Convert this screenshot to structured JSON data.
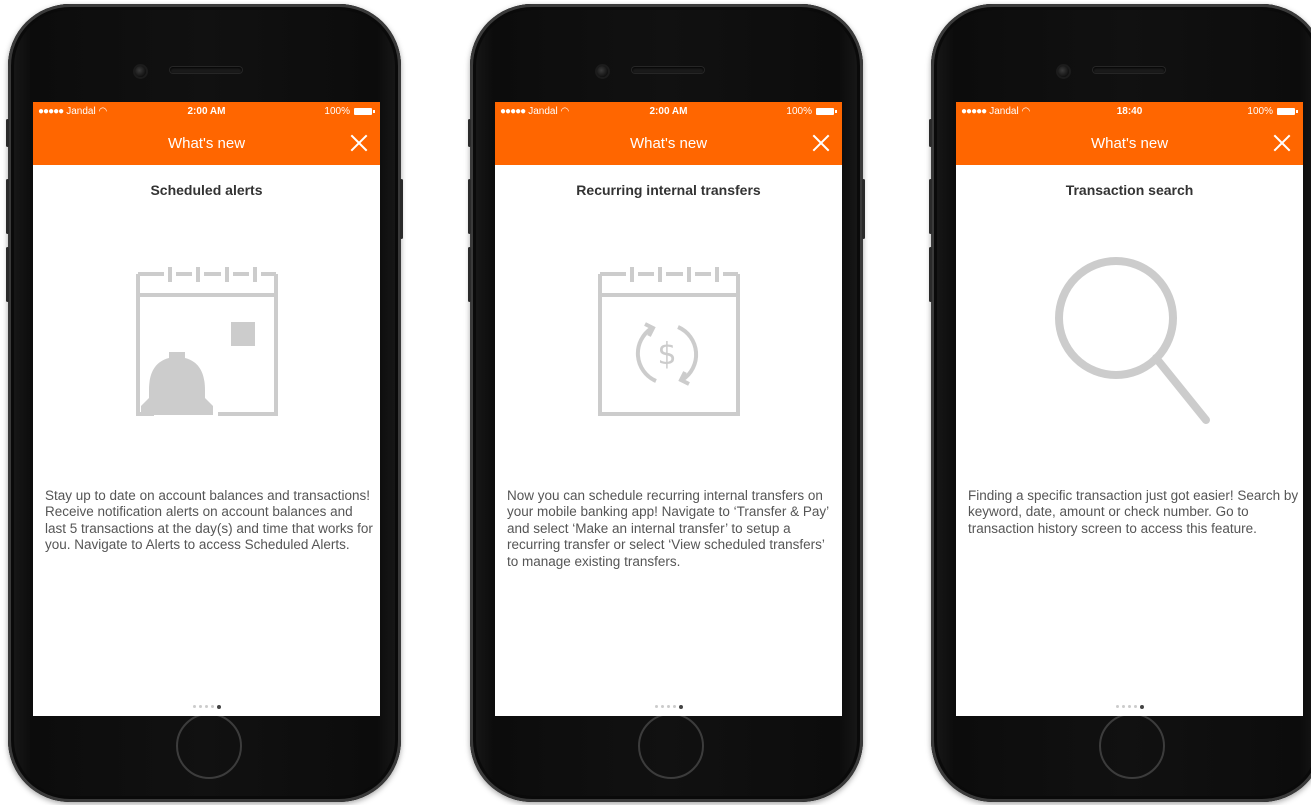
{
  "screens": [
    {
      "status": {
        "carrier": "Jandal",
        "time": "2:00 AM",
        "battery": "100%"
      },
      "nav_title": "What's new",
      "feature_title": "Scheduled alerts",
      "illustration_icon": "calendar-bell-icon",
      "description": "Stay up to date on account balances and transactions! Receive notification alerts on account balances and last 5 transactions at the day(s) and time that works for you. Navigate to Alerts to access Scheduled Alerts.",
      "pager": {
        "count": 5,
        "active": 4
      }
    },
    {
      "status": {
        "carrier": "Jandal",
        "time": "2:00 AM",
        "battery": "100%"
      },
      "nav_title": "What's new",
      "feature_title": "Recurring internal transfers",
      "illustration_icon": "calendar-recurring-dollar-icon",
      "description": "Now you can schedule recurring internal transfers on your mobile banking app! Navigate to ‘Transfer & Pay’ and select ‘Make an internal transfer’ to setup a recurring transfer or select ‘View scheduled transfers’ to manage existing transfers.",
      "pager": {
        "count": 5,
        "active": 4
      }
    },
    {
      "status": {
        "carrier": "Jandal",
        "time": "18:40",
        "battery": "100%"
      },
      "nav_title": "What's new",
      "feature_title": "Transaction search",
      "illustration_icon": "magnifier-icon",
      "description": "Finding a specific transaction just got easier! Search by keyword, date, amount or check number. Go to transaction history screen to access this feature.",
      "pager": {
        "count": 5,
        "active": 4
      }
    }
  ],
  "colors": {
    "brand_orange": "#ff6600",
    "illustration_gray": "#cccccc",
    "title_text": "#333333",
    "body_text": "#555555"
  }
}
